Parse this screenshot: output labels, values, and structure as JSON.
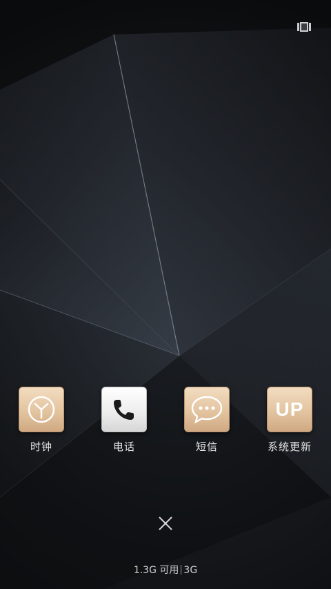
{
  "apps": [
    {
      "label": "时钟",
      "icon": "clock-icon"
    },
    {
      "label": "电话",
      "icon": "phone-icon"
    },
    {
      "label": "短信",
      "icon": "message-bubble-icon"
    },
    {
      "label": "系统更新",
      "icon": "up-icon",
      "icon_text": "UP"
    }
  ],
  "memory": {
    "available": "1.3G 可用",
    "total": "3G"
  },
  "icons": {
    "menu": "card-stack-icon",
    "close": "close-icon"
  },
  "colors": {
    "gold_tile": "#e3c4a0",
    "background": "#0d0e10",
    "label": "#e6e6e6"
  }
}
